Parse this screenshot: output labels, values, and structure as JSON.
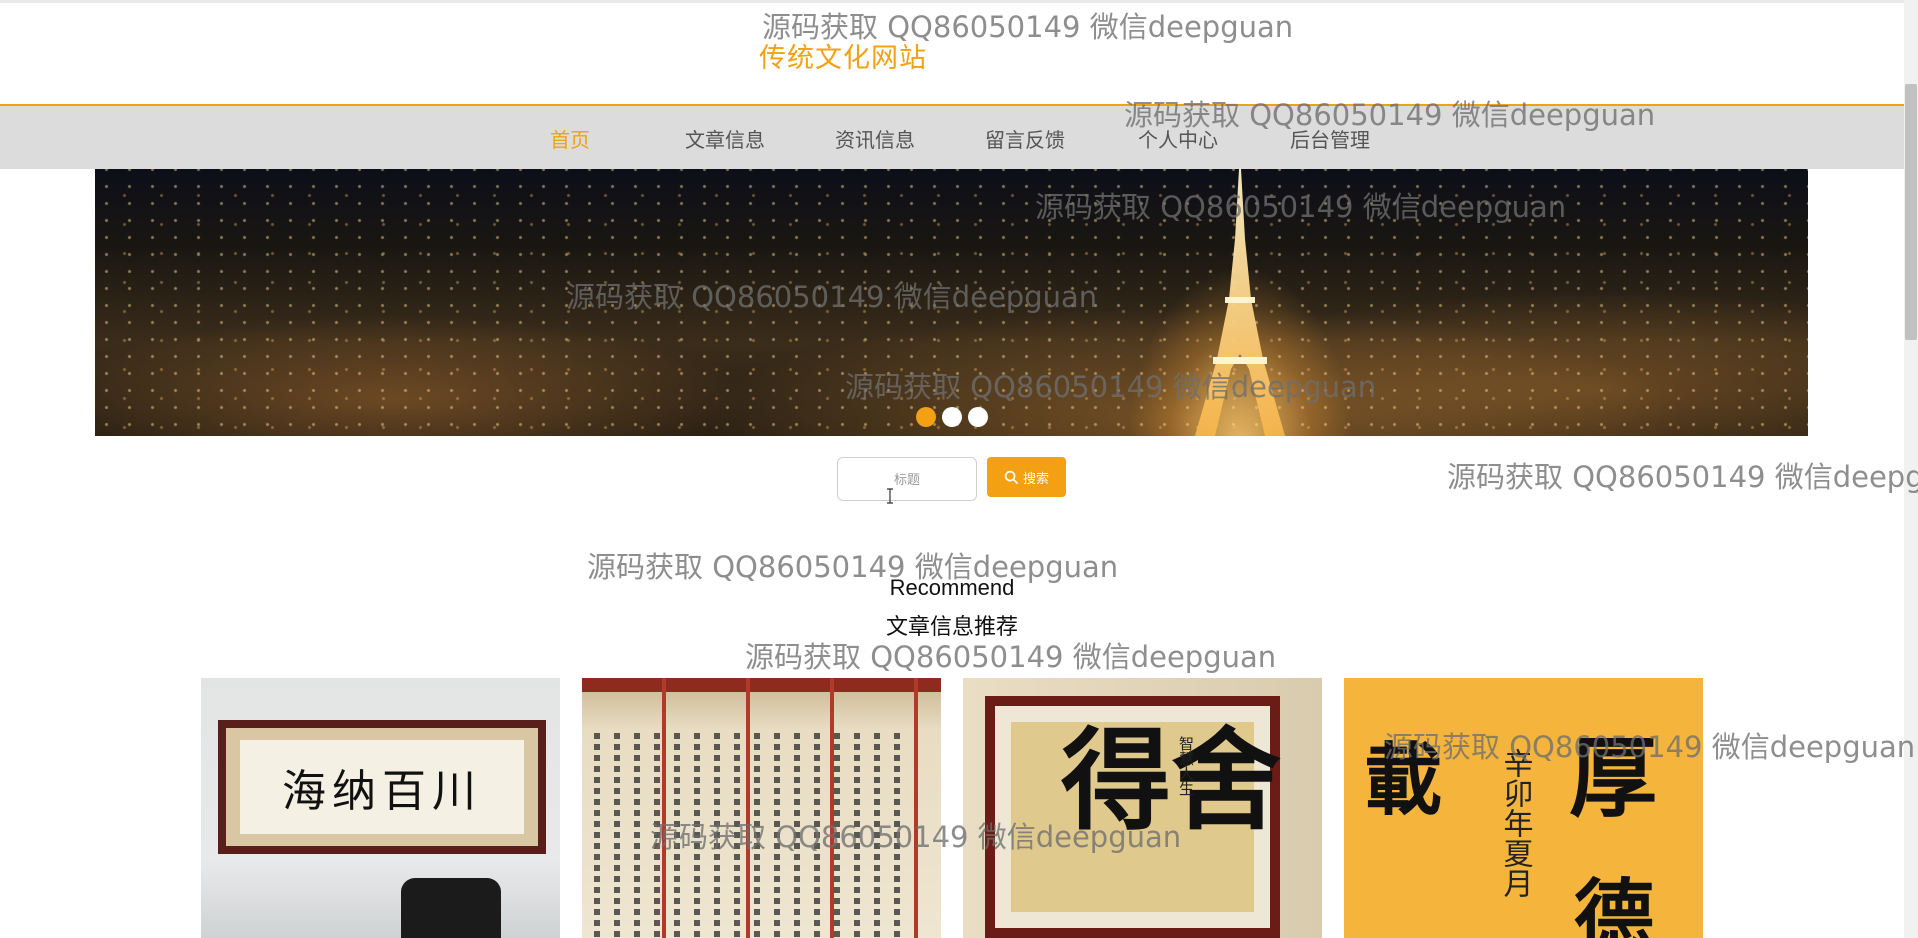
{
  "site": {
    "title": "传统文化网站"
  },
  "nav": {
    "items": [
      {
        "label": "首页",
        "active": true
      },
      {
        "label": "文章信息",
        "active": false
      },
      {
        "label": "资讯信息",
        "active": false
      },
      {
        "label": "留言反馈",
        "active": false
      },
      {
        "label": "个人中心",
        "active": false
      },
      {
        "label": "后台管理",
        "active": false
      }
    ]
  },
  "carousel": {
    "prev_icon": "chevron-left-icon",
    "next_icon": "chevron-right-icon",
    "active_index": 0,
    "slide_count": 3
  },
  "search": {
    "placeholder": "标题",
    "button_label": "搜索",
    "icon": "search-icon"
  },
  "section": {
    "title_en": "Recommend",
    "title_cn": "文章信息推荐"
  },
  "cards": {
    "card1": {
      "calligraphy": "海纳百川"
    },
    "card3": {
      "big": "舍得",
      "side": "智慧人生"
    },
    "card4": {
      "big1": "載",
      "big2": "厚",
      "big3": "德",
      "side": "辛卯年夏月"
    }
  },
  "watermark": {
    "text": "源码获取 QQ86050149 微信deepguan"
  },
  "colors": {
    "accent": "#f3a012",
    "nav_bg": "#dcdcdc"
  }
}
